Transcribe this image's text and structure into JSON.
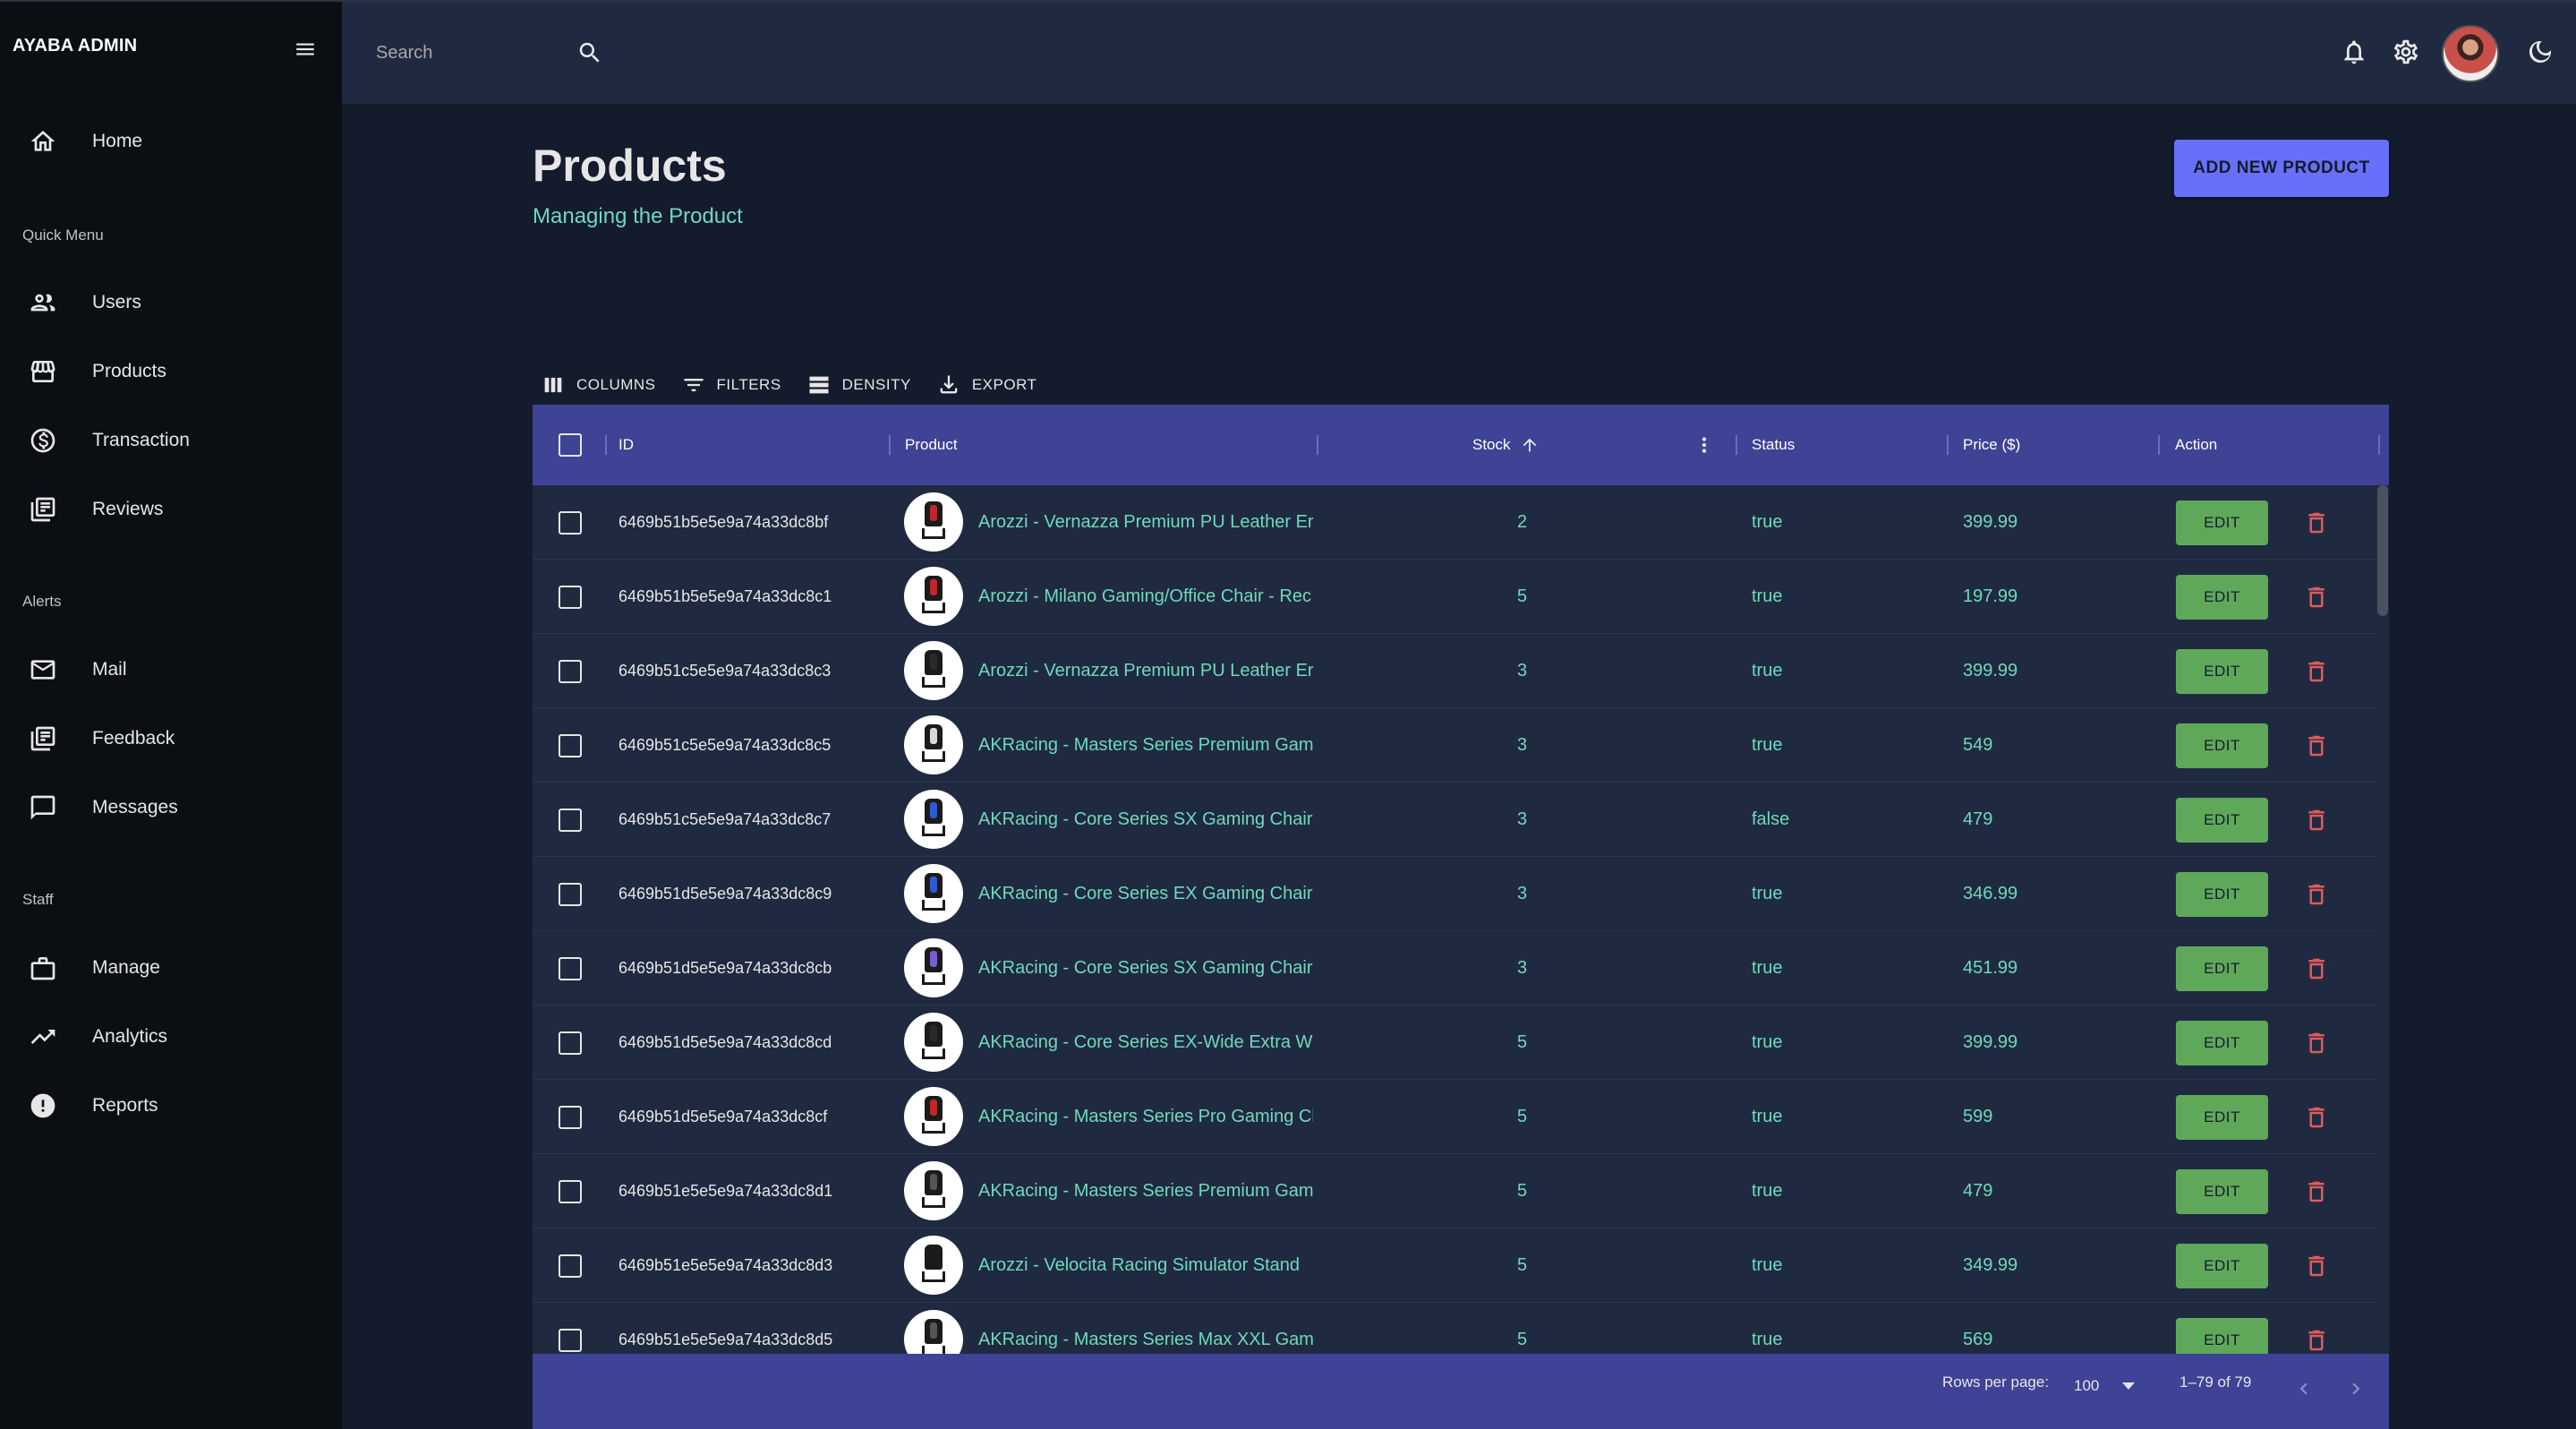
{
  "sidebar": {
    "brand": "AYABA ADMIN",
    "items": [
      {
        "label": "Home",
        "icon": "home-icon"
      },
      {
        "label": "Users",
        "icon": "users-icon"
      },
      {
        "label": "Products",
        "icon": "storefront-icon"
      },
      {
        "label": "Transaction",
        "icon": "dollar-circle-icon"
      },
      {
        "label": "Reviews",
        "icon": "library-icon"
      },
      {
        "label": "Mail",
        "icon": "mail-icon"
      },
      {
        "label": "Feedback",
        "icon": "library-icon"
      },
      {
        "label": "Messages",
        "icon": "chat-icon"
      },
      {
        "label": "Manage",
        "icon": "briefcase-icon"
      },
      {
        "label": "Analytics",
        "icon": "trending-up-icon"
      },
      {
        "label": "Reports",
        "icon": "alert-circle-icon"
      }
    ],
    "sections": {
      "quick_menu": "Quick Menu",
      "alerts": "Alerts",
      "staff": "Staff"
    }
  },
  "topbar": {
    "search_placeholder": "Search",
    "icons": [
      "bell-icon",
      "gear-icon",
      "avatar",
      "moon-icon"
    ]
  },
  "header": {
    "title": "Products",
    "subtitle": "Managing the Product",
    "add_button": "ADD NEW PRODUCT"
  },
  "toolbar": {
    "columns": "COLUMNS",
    "filters": "FILTERS",
    "density": "DENSITY",
    "export": "EXPORT"
  },
  "table": {
    "headers": {
      "id": "ID",
      "product": "Product",
      "stock": "Stock",
      "status": "Status",
      "price": "Price ($)",
      "action": "Action"
    },
    "edit_label": "EDIT",
    "rows": [
      {
        "id": "6469b51b5e5e9a74a33dc8bf",
        "product": "Arozzi - Vernazza Premium PU Leather Er",
        "stock": "2",
        "status": "true",
        "price": "399.99",
        "accent": "#c0272d"
      },
      {
        "id": "6469b51b5e5e9a74a33dc8c1",
        "product": "Arozzi - Milano Gaming/Office Chair - Rec",
        "stock": "5",
        "status": "true",
        "price": "197.99",
        "accent": "#c0272d"
      },
      {
        "id": "6469b51c5e5e9a74a33dc8c3",
        "product": "Arozzi - Vernazza Premium PU Leather Er",
        "stock": "3",
        "status": "true",
        "price": "399.99",
        "accent": "#2a2a2a"
      },
      {
        "id": "6469b51c5e5e9a74a33dc8c5",
        "product": "AKRacing - Masters Series Premium Gam",
        "stock": "3",
        "status": "true",
        "price": "549",
        "accent": "#d8d8d8"
      },
      {
        "id": "6469b51c5e5e9a74a33dc8c7",
        "product": "AKRacing - Core Series SX Gaming Chair -",
        "stock": "3",
        "status": "false",
        "price": "479",
        "accent": "#2f5bd1"
      },
      {
        "id": "6469b51d5e5e9a74a33dc8c9",
        "product": "AKRacing - Core Series EX Gaming Chair -",
        "stock": "3",
        "status": "true",
        "price": "346.99",
        "accent": "#2f5bd1"
      },
      {
        "id": "6469b51d5e5e9a74a33dc8cb",
        "product": "AKRacing - Core Series SX Gaming Chair -",
        "stock": "3",
        "status": "true",
        "price": "451.99",
        "accent": "#7a5cd6"
      },
      {
        "id": "6469b51d5e5e9a74a33dc8cd",
        "product": "AKRacing - Core Series EX-Wide Extra Wic",
        "stock": "5",
        "status": "true",
        "price": "399.99",
        "accent": "#2a2a2a"
      },
      {
        "id": "6469b51d5e5e9a74a33dc8cf",
        "product": "AKRacing - Masters Series Pro Gaming Ch",
        "stock": "5",
        "status": "true",
        "price": "599",
        "accent": "#c0272d"
      },
      {
        "id": "6469b51e5e5e9a74a33dc8d1",
        "product": "AKRacing - Masters Series Premium Gam",
        "stock": "5",
        "status": "true",
        "price": "479",
        "accent": "#555555"
      },
      {
        "id": "6469b51e5e5e9a74a33dc8d3",
        "product": "Arozzi - Velocita Racing Simulator Stand",
        "stock": "5",
        "status": "true",
        "price": "349.99",
        "accent": "#1b1b1b"
      },
      {
        "id": "6469b51e5e5e9a74a33dc8d5",
        "product": "AKRacing - Masters Series Max XXL Gamii",
        "stock": "5",
        "status": "true",
        "price": "569",
        "accent": "#555555"
      }
    ]
  },
  "footer": {
    "rows_per_page_label": "Rows per page:",
    "rows_per_page_value": "100",
    "range": "1–79 of 79"
  },
  "colors": {
    "accent_green": "#70d8bd",
    "header_blue": "#3e4396",
    "button_purple": "#6870fa",
    "edit_green": "#5fa85a",
    "delete_red": "#e05a5a"
  }
}
